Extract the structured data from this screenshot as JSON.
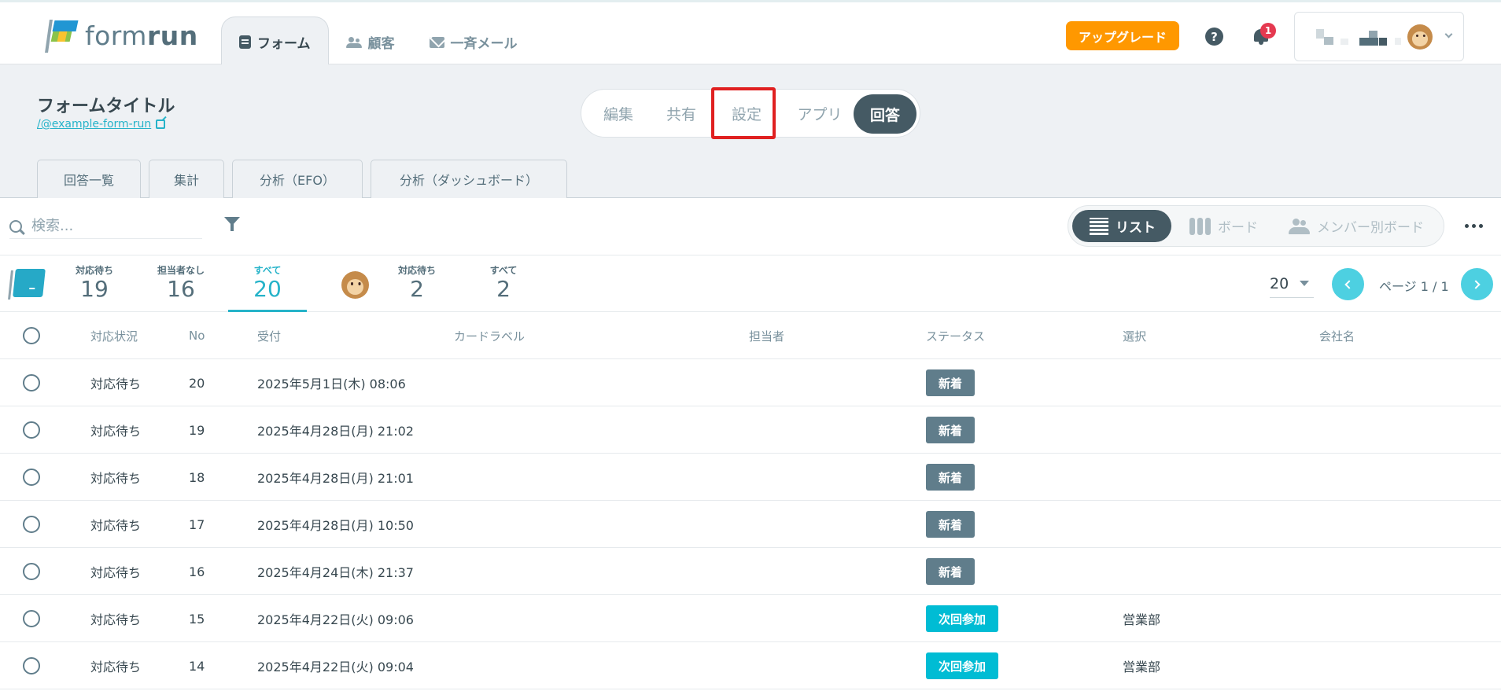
{
  "app": {
    "logo_text_light": "form",
    "logo_text_bold": "run"
  },
  "nav": {
    "tabs": [
      {
        "label": "フォーム",
        "icon": "form-icon",
        "active": true
      },
      {
        "label": "顧客",
        "icon": "customers-icon",
        "active": false
      },
      {
        "label": "一斉メール",
        "icon": "mail-icon",
        "active": false
      }
    ],
    "upgrade_label": "アップグレード",
    "help_label": "?",
    "notification_count": "1"
  },
  "form": {
    "title": "フォームタイトル",
    "link": "/@example-form-run"
  },
  "modes": {
    "items": [
      {
        "label": "編集",
        "active": false
      },
      {
        "label": "共有",
        "active": false
      },
      {
        "label": "設定",
        "active": false,
        "highlighted": true
      },
      {
        "label": "アプリ",
        "active": false
      },
      {
        "label": "回答",
        "active": true
      }
    ],
    "highlight_color": "#e02020"
  },
  "subtabs": [
    {
      "label": "回答一覧"
    },
    {
      "label": "集計"
    },
    {
      "label": "分析（EFO）"
    },
    {
      "label": "分析（ダッシュボード）"
    }
  ],
  "toolbar": {
    "search_placeholder": "検索...",
    "views": [
      {
        "label": "リスト",
        "icon": "list-icon",
        "active": true
      },
      {
        "label": "ボード",
        "icon": "board-icon",
        "active": false
      },
      {
        "label": "メンバー別ボード",
        "icon": "members-icon",
        "active": false
      }
    ]
  },
  "counters": {
    "team": [
      {
        "label": "対応待ち",
        "count": "19"
      },
      {
        "label": "担当者なし",
        "count": "16"
      },
      {
        "label": "すべて",
        "count": "20",
        "active": true
      }
    ],
    "mine": [
      {
        "label": "対応待ち",
        "count": "2"
      },
      {
        "label": "すべて",
        "count": "2"
      }
    ]
  },
  "pagination": {
    "per_page": "20",
    "page_info": "ページ 1 / 1"
  },
  "table": {
    "columns": [
      "対応状況",
      "No",
      "受付",
      "カードラベル",
      "担当者",
      "ステータス",
      "選択",
      "会社名"
    ],
    "rows": [
      {
        "status": "対応待ち",
        "no": "20",
        "received": "2025年5月1日(木) 08:06",
        "tag": "新着",
        "tag_color": "#607d8b",
        "select": ""
      },
      {
        "status": "対応待ち",
        "no": "19",
        "received": "2025年4月28日(月) 21:02",
        "tag": "新着",
        "tag_color": "#607d8b",
        "select": ""
      },
      {
        "status": "対応待ち",
        "no": "18",
        "received": "2025年4月28日(月) 21:01",
        "tag": "新着",
        "tag_color": "#607d8b",
        "select": ""
      },
      {
        "status": "対応待ち",
        "no": "17",
        "received": "2025年4月28日(月) 10:50",
        "tag": "新着",
        "tag_color": "#607d8b",
        "select": ""
      },
      {
        "status": "対応待ち",
        "no": "16",
        "received": "2025年4月24日(木) 21:37",
        "tag": "新着",
        "tag_color": "#607d8b",
        "select": ""
      },
      {
        "status": "対応待ち",
        "no": "15",
        "received": "2025年4月22日(火) 09:06",
        "tag": "次回参加",
        "tag_color": "#00bcd4",
        "select": "営業部"
      },
      {
        "status": "対応待ち",
        "no": "14",
        "received": "2025年4月22日(火) 09:04",
        "tag": "次回参加",
        "tag_color": "#00bcd4",
        "select": "営業部"
      }
    ]
  },
  "colors": {
    "accent": "#26b3c9",
    "upgrade": "#ff9800",
    "dark": "#455a64"
  }
}
